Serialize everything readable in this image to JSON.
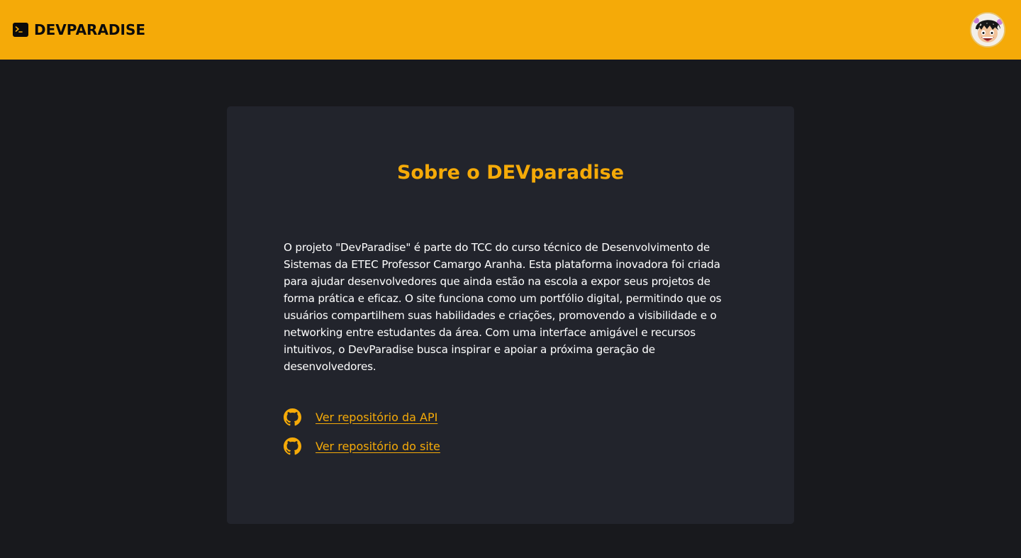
{
  "header": {
    "brand_name": "DEVPARADISE",
    "brand_icon": "terminal-icon",
    "avatar_icon": "user-avatar",
    "background_color": "#f5aa08"
  },
  "about": {
    "title": "Sobre o DEVparadise",
    "description": "O projeto \"DevParadise\" é parte do TCC do curso técnico de Desenvolvimento de Sistemas da ETEC Professor Camargo Aranha. Esta plataforma inovadora foi criada para ajudar desenvolvedores que ainda estão na escola a expor seus projetos de forma prática e eficaz. O site funciona como um portfólio digital, permitindo que os usuários compartilhem suas habilidades e criações, promovendo a visibilidade e o networking entre estudantes da área. Com uma interface amigável e recursos intuitivos, o DevParadise busca inspirar e apoiar a próxima geração de desenvolvedores.",
    "links": [
      {
        "label": "Ver repositório da API",
        "icon": "github-icon"
      },
      {
        "label": "Ver repositório do site",
        "icon": "github-icon"
      }
    ]
  },
  "colors": {
    "accent": "#f5aa08",
    "page_background": "#18191d",
    "card_background": "#22242c",
    "text": "#ffffff"
  }
}
